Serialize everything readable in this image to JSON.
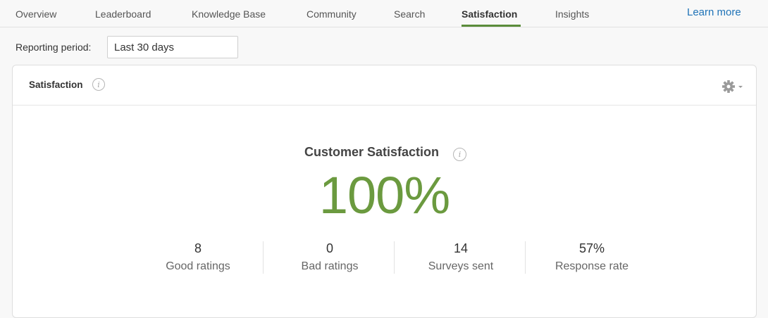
{
  "nav": {
    "tabs": [
      "Overview",
      "Leaderboard",
      "Knowledge Base",
      "Community",
      "Search",
      "Satisfaction",
      "Insights"
    ],
    "active_tab": "Satisfaction",
    "learn_more": "Learn more"
  },
  "filter": {
    "label": "Reporting period:",
    "value": "Last 30 days"
  },
  "card": {
    "title": "Satisfaction",
    "info_glyph": "i",
    "settings_icon": "gear-icon"
  },
  "csat": {
    "title": "Customer Satisfaction",
    "value": "100%"
  },
  "stats": [
    {
      "value": "8",
      "label": "Good ratings"
    },
    {
      "value": "0",
      "label": "Bad ratings"
    },
    {
      "value": "14",
      "label": "Surveys sent"
    },
    {
      "value": "57%",
      "label": "Response rate"
    }
  ],
  "colors": {
    "accent": "#5b8c3a",
    "csat_value": "#6b9a3f",
    "link": "#1f73b7"
  }
}
